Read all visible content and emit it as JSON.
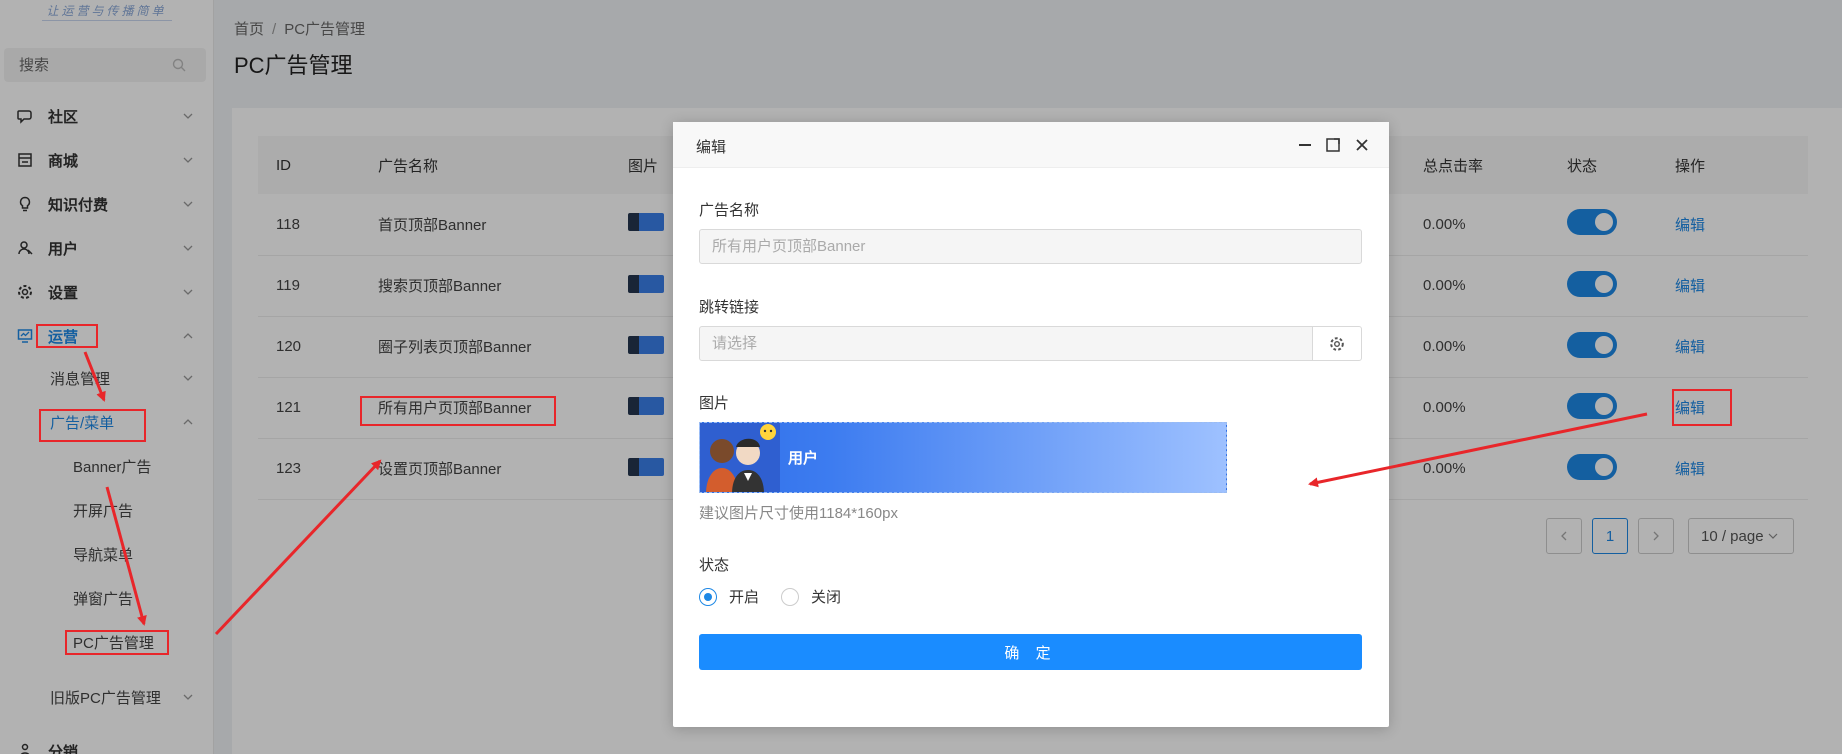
{
  "sidebar": {
    "logo_text": "让运营与传播简单",
    "search_placeholder": "搜索",
    "menu": [
      {
        "label": "社区",
        "icon": "chat-icon"
      },
      {
        "label": "商城",
        "icon": "store-icon"
      },
      {
        "label": "知识付费",
        "icon": "lightbulb-icon"
      },
      {
        "label": "用户",
        "icon": "user-icon"
      },
      {
        "label": "设置",
        "icon": "gear-icon"
      },
      {
        "label": "运营",
        "icon": "monitor-icon"
      }
    ],
    "sub": {
      "message": "消息管理",
      "ads": "广告/菜单",
      "banner": "Banner广告",
      "splash": "开屏广告",
      "nav": "导航菜单",
      "popup": "弹窗广告",
      "pc": "PC广告管理",
      "legacy": "旧版PC广告管理",
      "distribution": "分销"
    }
  },
  "breadcrumb": {
    "home": "首页",
    "current": "PC广告管理"
  },
  "page_title": "PC广告管理",
  "table": {
    "headers": {
      "id": "ID",
      "name": "广告名称",
      "image": "图片",
      "ctr": "总点击率",
      "status": "状态",
      "action": "操作"
    },
    "rows": [
      {
        "id": "118",
        "name": "首页顶部Banner",
        "ctr": "0.00%",
        "action": "编辑"
      },
      {
        "id": "119",
        "name": "搜索页顶部Banner",
        "ctr": "0.00%",
        "action": "编辑"
      },
      {
        "id": "120",
        "name": "圈子列表页顶部Banner",
        "ctr": "0.00%",
        "action": "编辑"
      },
      {
        "id": "121",
        "name": "所有用户页顶部Banner",
        "ctr": "0.00%",
        "action": "编辑"
      },
      {
        "id": "123",
        "name": "设置页顶部Banner",
        "ctr": "0.00%",
        "action": "编辑"
      }
    ]
  },
  "pagination": {
    "current": "1",
    "page_size": "10 / page"
  },
  "modal": {
    "title": "编辑",
    "name_label": "广告名称",
    "name_placeholder": "所有用户页顶部Banner",
    "link_label": "跳转链接",
    "link_placeholder": "请选择",
    "image_label": "图片",
    "banner_text": "用户",
    "hint": "建议图片尺寸使用1184*160px",
    "status_label": "状态",
    "status_on": "开启",
    "status_off": "关闭",
    "confirm": "确 定"
  },
  "colors": {
    "accent": "#1e88e5",
    "annotation": "#e8262a"
  }
}
